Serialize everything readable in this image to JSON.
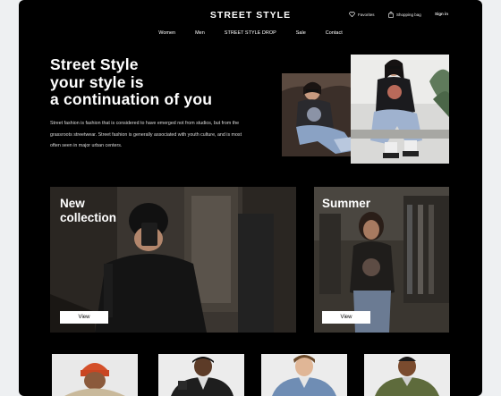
{
  "header": {
    "brand": "STREET STYLE",
    "favorites_label": "Favorites",
    "bag_label": "Shopping bag",
    "signin_label": "Sign in"
  },
  "nav": {
    "items": [
      "Women",
      "Men",
      "STREET STYLE DROP",
      "Sale",
      "Contact"
    ]
  },
  "hero": {
    "title_lines": [
      "Street Style",
      "your style is",
      "a continuation of you"
    ],
    "description": "Street fashion is fashion that is considered to have emerged not from studios, but from the grassroots streetwear. Street fashion is generally associated with youth culture, and is most often seen  in major urban centers."
  },
  "promos": [
    {
      "title_lines": [
        "New",
        "collection"
      ],
      "button": "View"
    },
    {
      "title_lines": [
        "Summer"
      ],
      "button": "View"
    }
  ],
  "colors": {
    "background": "#000000",
    "text": "#ffffff",
    "button_bg": "#ffffff"
  },
  "icons": {
    "favorites": "heart-icon",
    "bag": "shopping-bag-icon"
  }
}
